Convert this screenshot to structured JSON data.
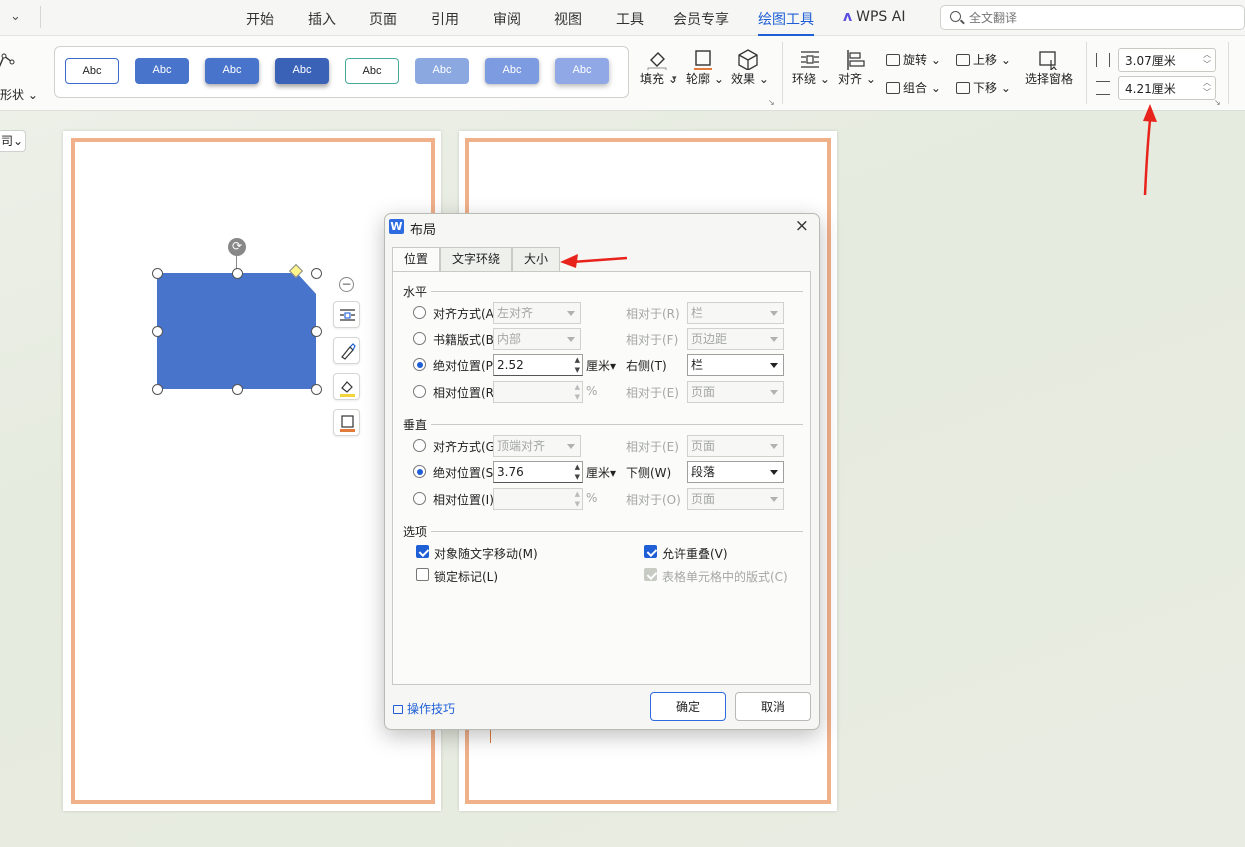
{
  "menubar": {
    "tabs": [
      "开始",
      "插入",
      "页面",
      "引用",
      "审阅",
      "视图",
      "工具",
      "会员专享",
      "绘图工具"
    ],
    "active_tab": "绘图工具",
    "wps_ai": "WPS AI",
    "search_placeholder": "全文翻译"
  },
  "ribbon": {
    "shape_label": "形状",
    "style_samples": [
      "Abc",
      "Abc",
      "Abc",
      "Abc",
      "Abc",
      "Abc",
      "Abc",
      "Abc"
    ],
    "fill": "填充",
    "outline": "轮廓",
    "effect": "效果",
    "wrap": "环绕",
    "align": "对齐",
    "rotate": "旋转",
    "group": "组合",
    "bring_forward": "上移",
    "send_backward": "下移",
    "selection_pane": "选择窗格",
    "height_value": "3.07厘米",
    "width_value": "4.21厘米"
  },
  "doc": {
    "left_stub": "司"
  },
  "dialog": {
    "title": "布局",
    "close": "×",
    "tabs": [
      "位置",
      "文字环绕",
      "大小"
    ],
    "active_tab": "位置",
    "horizontal": {
      "section": "水平",
      "rows": [
        {
          "label": "对齐方式(A)",
          "value": "左对齐",
          "rel_label": "相对于(R)",
          "rel_value": "栏",
          "enabled": false
        },
        {
          "label": "书籍版式(B)",
          "value": "内部",
          "rel_label": "相对于(F)",
          "rel_value": "页边距",
          "enabled": false
        },
        {
          "label": "绝对位置(P)",
          "value": "2.52",
          "unit": "厘米",
          "rel_label": "右侧(T)",
          "rel_value": "栏",
          "enabled": true,
          "selected": true
        },
        {
          "label": "相对位置(R)",
          "value": "",
          "unit": "%",
          "rel_label": "相对于(E)",
          "rel_value": "页面",
          "enabled": false
        }
      ]
    },
    "vertical": {
      "section": "垂直",
      "rows": [
        {
          "label": "对齐方式(G)",
          "value": "顶端对齐",
          "rel_label": "相对于(E)",
          "rel_value": "页面",
          "enabled": false
        },
        {
          "label": "绝对位置(S)",
          "value": "3.76",
          "unit": "厘米",
          "rel_label": "下侧(W)",
          "rel_value": "段落",
          "enabled": true,
          "selected": true
        },
        {
          "label": "相对位置(I)",
          "value": "",
          "unit": "%",
          "rel_label": "相对于(O)",
          "rel_value": "页面",
          "enabled": false
        }
      ]
    },
    "options": {
      "section": "选项",
      "move_with_text": "对象随文字移动(M)",
      "move_with_text_checked": true,
      "allow_overlap": "允许重叠(V)",
      "allow_overlap_checked": true,
      "lock_anchor": "锁定标记(L)",
      "lock_anchor_checked": false,
      "layout_in_cell": "表格单元格中的版式(C)",
      "layout_in_cell_checked": true
    },
    "tips": "操作技巧",
    "ok": "确定",
    "cancel": "取消"
  },
  "colors": {
    "accent": "#1f5fd6",
    "shape_fill": "#4874cb",
    "page_border": "#f0b08a",
    "annotation": "#e8231b"
  }
}
